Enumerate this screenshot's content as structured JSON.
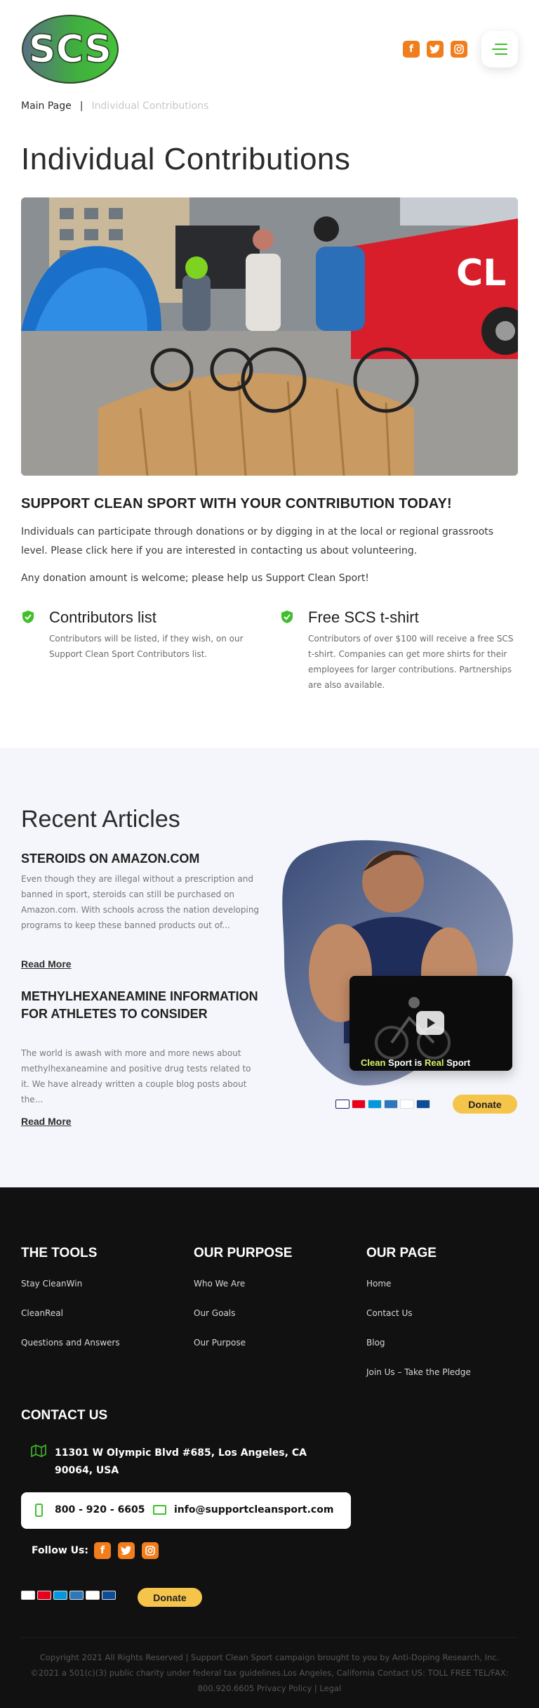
{
  "header": {
    "logo_text": "SCS",
    "socials": [
      {
        "icon": "facebook-icon",
        "glyph": "f"
      },
      {
        "icon": "twitter-icon",
        "glyph": "t"
      },
      {
        "icon": "instagram-icon",
        "glyph": "◎"
      }
    ],
    "menu_icon": "hamburger-icon"
  },
  "breadcrumb": {
    "home": "Main Page",
    "separator": "|",
    "current": "Individual Contributions"
  },
  "page_title": "Individual Contributions",
  "support": {
    "heading": "SUPPORT CLEAN SPORT WITH YOUR CONTRIBUTION TODAY!",
    "paragraph1": "Individuals can participate through donations or by digging in at the local or regional grassroots level. Please click here if you are interested in contacting us about volunteering.",
    "paragraph2": "Any donation amount is welcome; please help us Support Clean Sport!"
  },
  "features": [
    {
      "title": "Contributors list",
      "body": "Contributors will be listed, if they wish, on our Support Clean Sport Contributors list."
    },
    {
      "title": "Free SCS t-shirt",
      "body": "Contributors of over $100 will receive a free SCS t-shirt. Companies can get more shirts for their employees for larger contributions. Partnerships are also available."
    }
  ],
  "recent": {
    "heading": "Recent Articles",
    "articles": [
      {
        "title": "STEROIDS ON AMAZON.COM",
        "excerpt": "Even though they are illegal without a prescription and banned in sport, steroids can still be purchased on Amazon.com. With schools across the nation developing programs to keep these banned products out of...",
        "link": "Read More"
      },
      {
        "title": "METHYLHEXANEAMINE INFORMATION FOR ATHLETES TO CONSIDER",
        "excerpt": "The world is awash with more and more news about methylhexaneamine and positive drug tests related to it.  We have already written a couple blog posts about the...",
        "link": "Read More"
      }
    ],
    "video_caption": {
      "w1": "Clean",
      "w2": " Sport is ",
      "w3": "Real",
      "w4": " Sport"
    },
    "donate_label": "Donate"
  },
  "footer": {
    "columns": [
      {
        "title": "THE TOOLS",
        "links": [
          "Stay CleanWin",
          "CleanReal",
          "Questions and Answers"
        ]
      },
      {
        "title": "OUR PURPOSE",
        "links": [
          "Who We Are",
          "Our Goals",
          "Our Purpose"
        ]
      },
      {
        "title": "OUR PAGE",
        "links": [
          "Home",
          "Contact Us",
          "Blog",
          "Join Us – Take the Pledge"
        ]
      }
    ],
    "contact_title": "CONTACT US",
    "address": "11301 W Olympic Blvd #685, Los Angeles, CA 90064, USA",
    "phone": "800 - 920 - 6605",
    "email": "info@supportcleansport.com",
    "follow_label": "Follow Us:",
    "donate_label": "Donate",
    "copyright": "Copyright 2021 All Rights Reserved | Support Clean Sport campaign brought to you by Anti-Doping Research, Inc. ©2021 a 501(c)(3) public charity under federal tax guidelines.Los Angeles, California Contact US: TOLL FREE TEL/FAX: 800.920.6605 Privacy Policy | Legal"
  },
  "colors": {
    "accent_green": "#3fbf2a",
    "social_orange": "#f27d1c",
    "donate_yellow": "#f5c44b",
    "footer_bg": "#111111",
    "section_bg": "#f5f6fb"
  }
}
